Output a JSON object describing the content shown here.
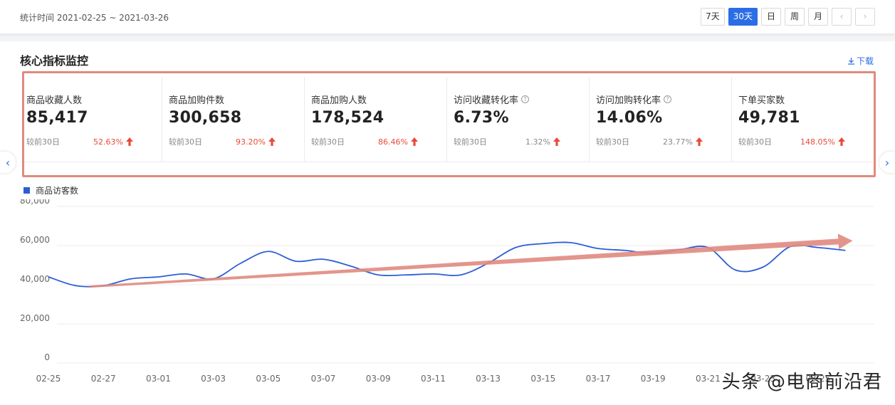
{
  "header": {
    "period": "统计时间 2021-02-25 ~ 2021-03-26",
    "buttons": [
      "7天",
      "30天",
      "日",
      "周",
      "月"
    ],
    "prev_icon": "chevron-left-icon",
    "next_icon": "chevron-right-icon"
  },
  "section": {
    "title": "核心指标监控",
    "download_label": "下载",
    "download_icon": "download-icon"
  },
  "metrics": [
    {
      "label": "商品收藏人数",
      "value": "85,417",
      "compare": "较前30日",
      "pct": "52.63%",
      "trend": "up",
      "color": "red",
      "help": false
    },
    {
      "label": "商品加购件数",
      "value": "300,658",
      "compare": "较前30日",
      "pct": "93.20%",
      "trend": "up",
      "color": "red",
      "help": false
    },
    {
      "label": "商品加购人数",
      "value": "178,524",
      "compare": "较前30日",
      "pct": "86.46%",
      "trend": "up",
      "color": "red",
      "help": false
    },
    {
      "label": "访问收藏转化率",
      "value": "6.73%",
      "compare": "较前30日",
      "pct": "1.32%",
      "trend": "up",
      "color": "gray",
      "help": true
    },
    {
      "label": "访问加购转化率",
      "value": "14.06%",
      "compare": "较前30日",
      "pct": "23.77%",
      "trend": "up",
      "color": "gray",
      "help": true
    },
    {
      "label": "下单买家数",
      "value": "49,781",
      "compare": "较前30日",
      "pct": "148.05%",
      "trend": "up",
      "color": "red",
      "help": false
    }
  ],
  "colors": {
    "accent": "#2b6de5",
    "up_red": "#e84a3a",
    "highlight_box": "#e08a7f",
    "trend_arrow": "#e08a7f",
    "series_line": "#2b5ed6"
  },
  "chart_data": {
    "type": "line",
    "legend": "商品访客数",
    "legend_placement": "top-left",
    "grid": true,
    "y_ticks": [
      "80,000",
      "60,000",
      "40,000",
      "20,000",
      "0"
    ],
    "ylim": [
      0,
      80000
    ],
    "x_ticks": [
      "02-25",
      "02-27",
      "03-01",
      "03-03",
      "03-05",
      "03-07",
      "03-09",
      "03-11",
      "03-13",
      "03-15",
      "03-17",
      "03-19",
      "03-21",
      "03-23",
      "03-25"
    ],
    "x": [
      "02-25",
      "02-26",
      "02-27",
      "02-28",
      "03-01",
      "03-02",
      "03-03",
      "03-04",
      "03-05",
      "03-06",
      "03-07",
      "03-08",
      "03-09",
      "03-10",
      "03-11",
      "03-12",
      "03-13",
      "03-14",
      "03-15",
      "03-16",
      "03-17",
      "03-18",
      "03-19",
      "03-20",
      "03-21",
      "03-22",
      "03-23",
      "03-24",
      "03-25",
      "03-26"
    ],
    "series": [
      {
        "name": "商品访客数",
        "values": [
          44000,
          39500,
          39500,
          43000,
          44000,
          45500,
          43000,
          51000,
          57000,
          52000,
          53000,
          49500,
          45000,
          45000,
          45500,
          45000,
          51000,
          59000,
          61000,
          61500,
          58500,
          57500,
          56000,
          58000,
          59000,
          47500,
          49000,
          59500,
          59000,
          57500
        ]
      }
    ],
    "annotation": {
      "type": "trend-arrow",
      "from": [
        "02-27",
        39000
      ],
      "to": [
        "03-26",
        62500
      ]
    }
  },
  "watermark": "头条 @电商前沿君"
}
